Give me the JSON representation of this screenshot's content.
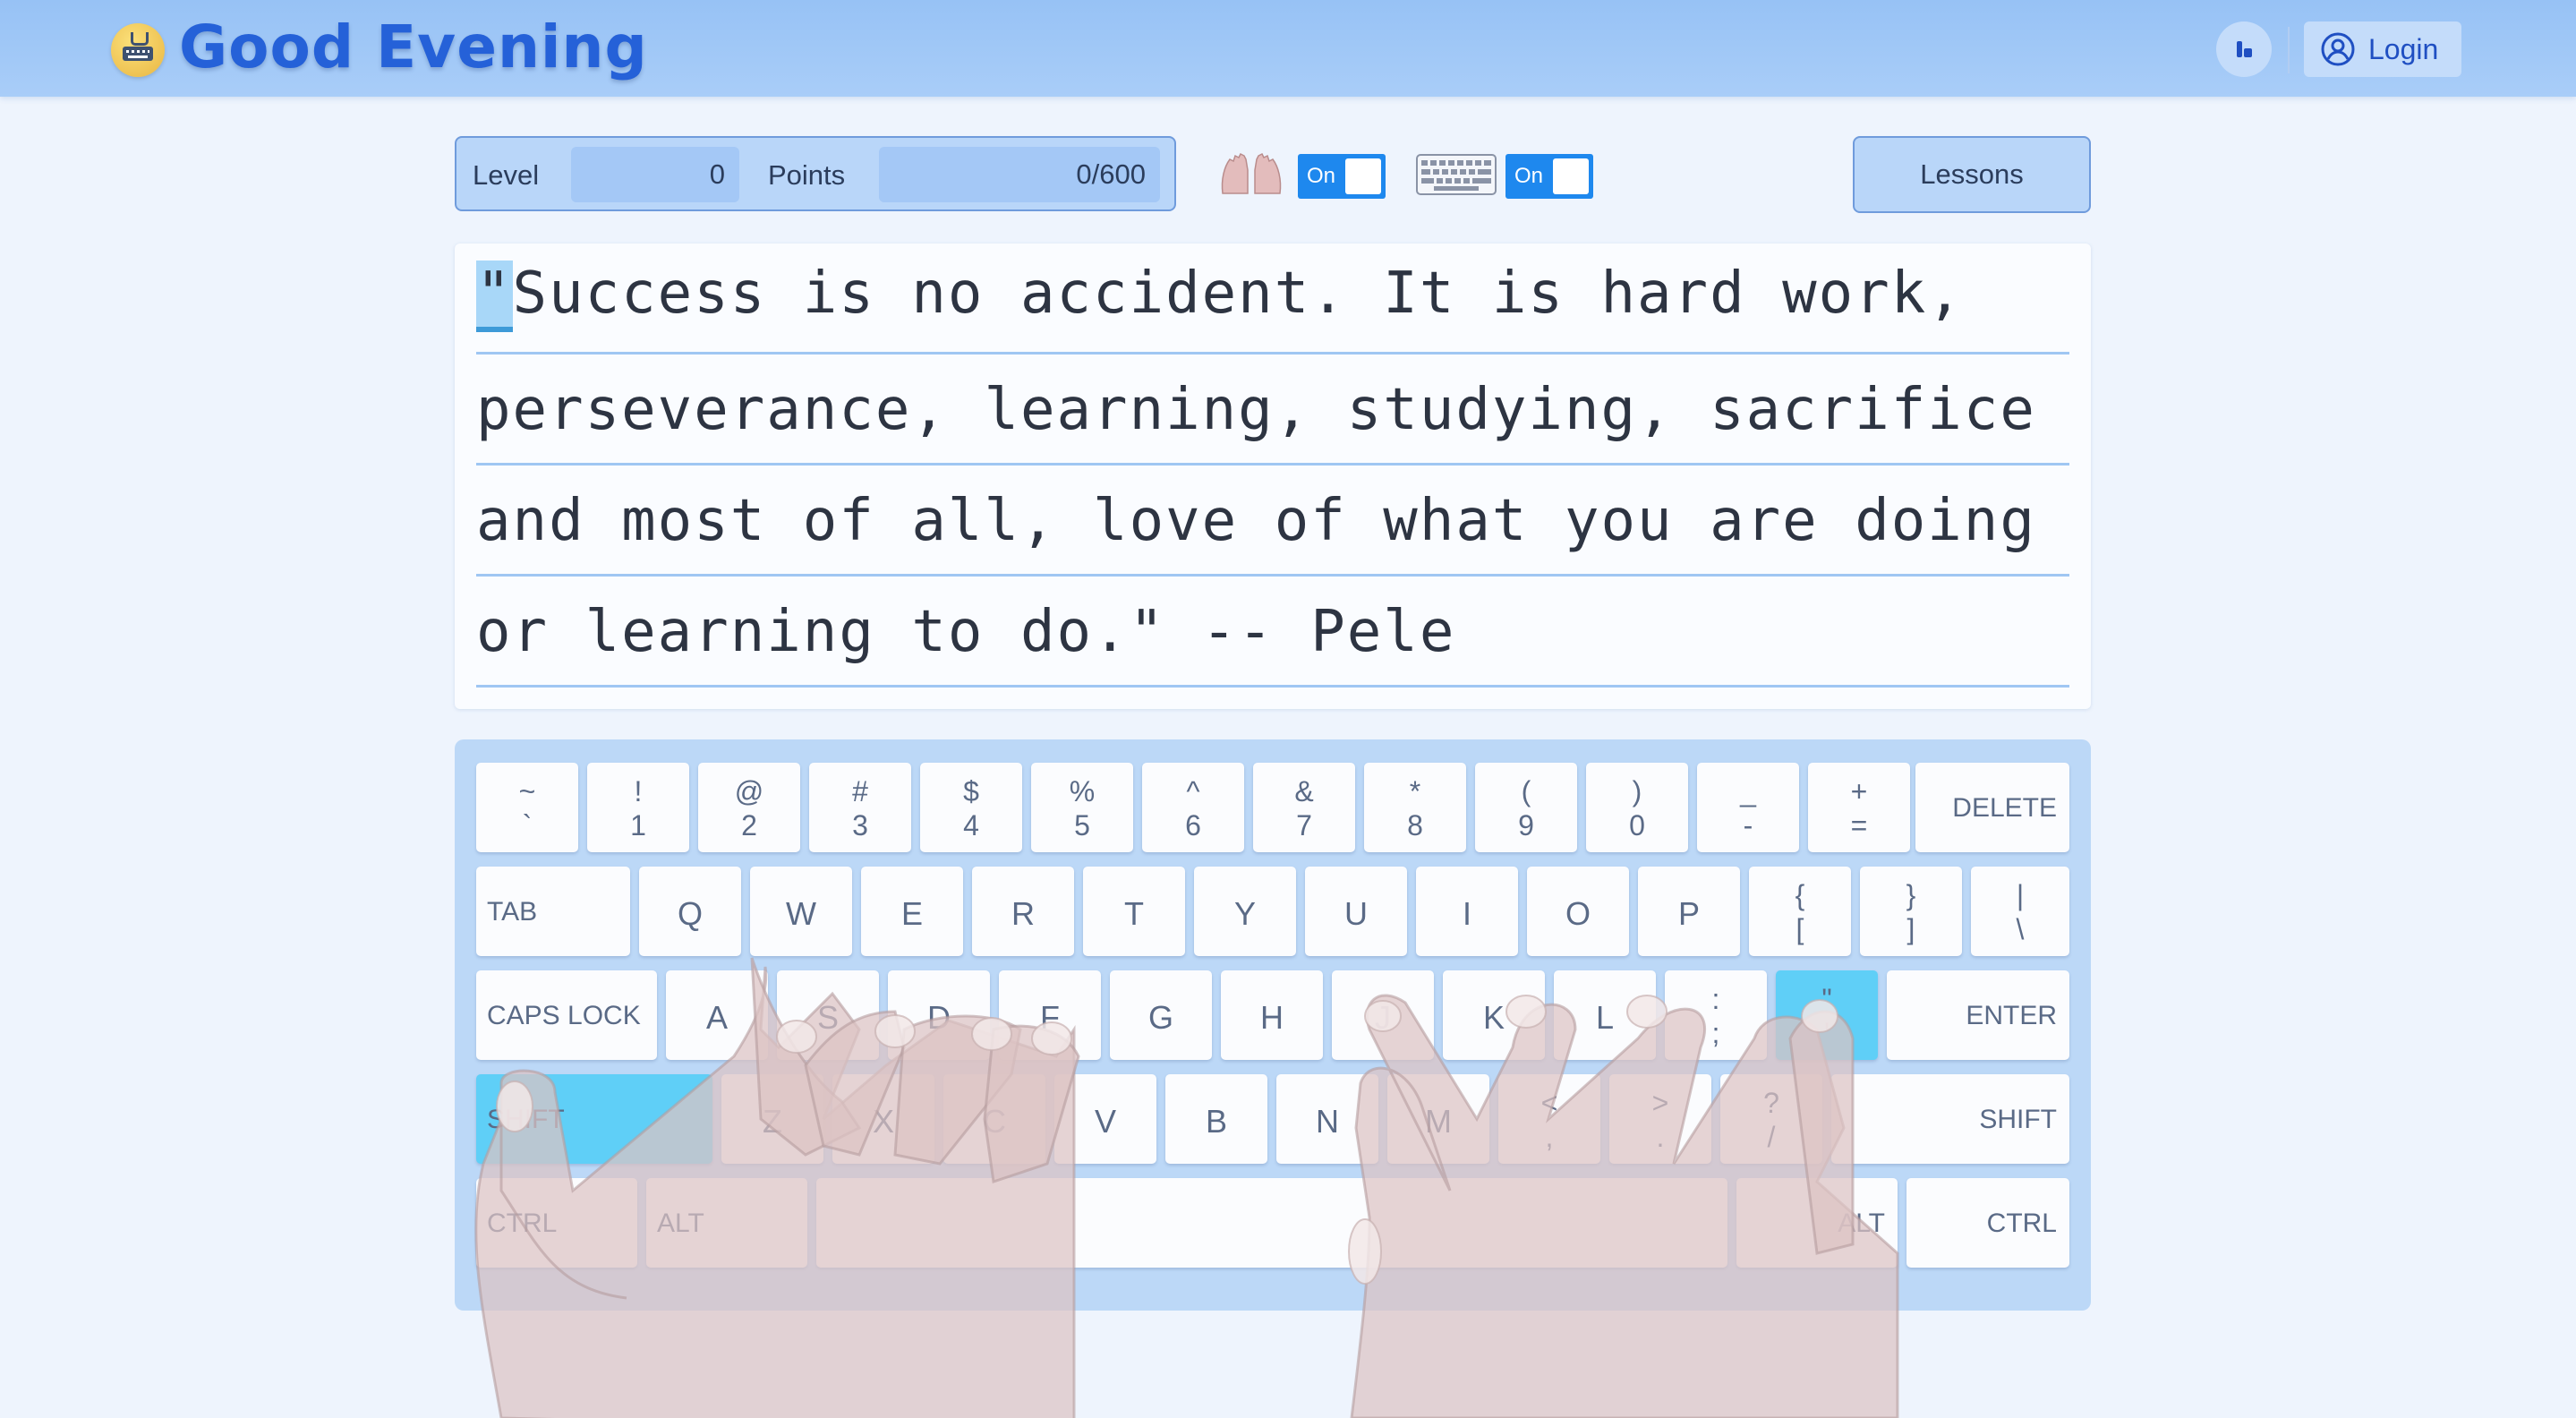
{
  "header": {
    "title": "Good Evening",
    "login_label": "Login"
  },
  "stats": {
    "level_label": "Level",
    "level_value": "0",
    "points_label": "Points",
    "points_value": "0/600"
  },
  "toggles": {
    "hands_state": "On",
    "keyboard_state": "On"
  },
  "lessons_label": "Lessons",
  "passage": {
    "current_char": "\"",
    "lines": [
      "Success is no accident. It is hard work,",
      "perseverance, learning, studying, sacrifice",
      "and most of all, love of what you are doing",
      "or learning to do.\" -- Pele"
    ]
  },
  "keyboard": {
    "row1": [
      {
        "top": "~",
        "bot": "`"
      },
      {
        "top": "!",
        "bot": "1"
      },
      {
        "top": "@",
        "bot": "2"
      },
      {
        "top": "#",
        "bot": "3"
      },
      {
        "top": "$",
        "bot": "4"
      },
      {
        "top": "%",
        "bot": "5"
      },
      {
        "top": "^",
        "bot": "6"
      },
      {
        "top": "&",
        "bot": "7"
      },
      {
        "top": "*",
        "bot": "8"
      },
      {
        "top": "(",
        "bot": "9"
      },
      {
        "top": ")",
        "bot": "0"
      },
      {
        "top": "_",
        "bot": "-"
      },
      {
        "top": "+",
        "bot": "="
      }
    ],
    "delete": "DELETE",
    "tab": "TAB",
    "row2": [
      "Q",
      "W",
      "E",
      "R",
      "T",
      "Y",
      "U",
      "I",
      "O",
      "P"
    ],
    "row2_sym": [
      {
        "top": "{",
        "bot": "["
      },
      {
        "top": "}",
        "bot": "]"
      },
      {
        "top": "|",
        "bot": "\\"
      }
    ],
    "caps": "CAPS LOCK",
    "row3": [
      "A",
      "S",
      "D",
      "F",
      "G",
      "H",
      "J",
      "K",
      "L"
    ],
    "row3_sym": [
      {
        "top": ":",
        "bot": ";"
      },
      {
        "top": "\"",
        "bot": "'"
      }
    ],
    "enter": "ENTER",
    "shift": "SHIFT",
    "row4": [
      "Z",
      "X",
      "C",
      "V",
      "B",
      "N",
      "M"
    ],
    "row4_sym": [
      {
        "top": "<",
        "bot": ","
      },
      {
        "top": ">",
        "bot": "."
      },
      {
        "top": "?",
        "bot": "/"
      }
    ],
    "ctrl": "CTRL",
    "alt": "ALT",
    "highlight_color": "#5fcff7"
  }
}
